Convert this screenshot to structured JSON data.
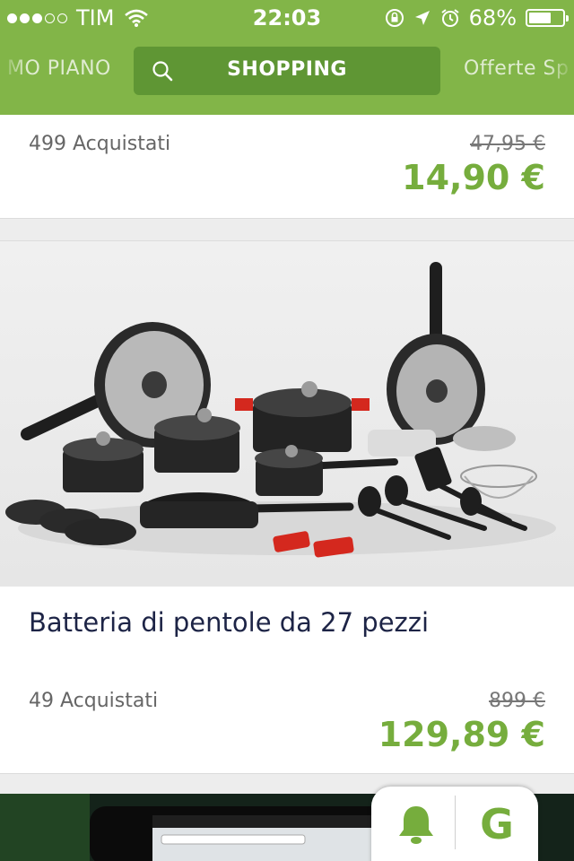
{
  "status_bar": {
    "carrier": "TIM",
    "time": "22:03",
    "battery": "68%",
    "battery_level": 0.68,
    "signal_bars": 3,
    "signal_total": 5
  },
  "tabs": {
    "left_partial": "MO PIANO",
    "active": "SHOPPING",
    "right_partial": "Offerte Sp"
  },
  "deals": [
    {
      "bought": "499 Acquistati",
      "old_price": "47,95 €",
      "new_price": "14,90 €"
    },
    {
      "title": "Batteria di pentole da 27 pezzi",
      "bought": "49 Acquistati",
      "old_price": "899 €",
      "new_price": "129,89 €"
    }
  ],
  "bottom_bar": {
    "bell_icon": "bell-icon",
    "brand_letter": "G"
  },
  "colors": {
    "brand_green": "#82b548",
    "active_tab": "#5f9634",
    "price_green": "#76ad3d"
  }
}
